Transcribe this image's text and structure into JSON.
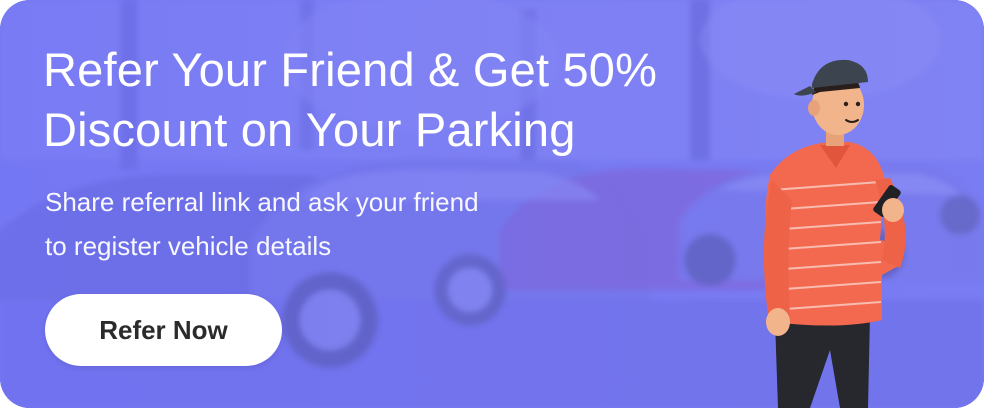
{
  "banner": {
    "headline_line1": "Refer Your Friend & Get 50%",
    "headline_line2": "Discount on Your Parking",
    "subtext_line1": "Share referral link and ask your friend",
    "subtext_line2": "to register vehicle details",
    "cta_label": "Refer Now"
  },
  "colors": {
    "accent": "#6c6ff0",
    "button_bg": "#ffffff",
    "button_text": "#2b2b2b",
    "shirt": "#f2694f",
    "pants": "#26282e"
  },
  "illustration": {
    "name": "man-with-phone-illustration",
    "background": "parking-lot-photo"
  }
}
